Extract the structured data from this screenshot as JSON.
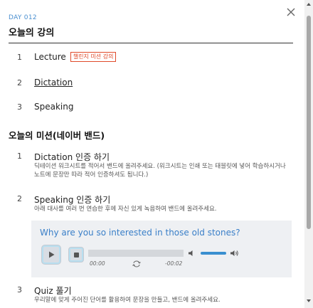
{
  "header": {
    "day": "DAY 012",
    "title": "오늘의 강의"
  },
  "lectures": [
    {
      "num": "1",
      "label": "Lecture",
      "badge": "챌린지 미션 강의"
    },
    {
      "num": "2",
      "label": "Dictation"
    },
    {
      "num": "3",
      "label": "Speaking"
    }
  ],
  "mission": {
    "title": "오늘의 미션(네이버 밴드)",
    "items": [
      {
        "num": "1",
        "title": "Dictation 인증 하기",
        "desc": "딕테이션 워크시트를 적어서 밴드에 올려주세요. (워크시트는 인쇄 또는 태블릿에 넣어 학습하시거나 노트에 문장만 따라 적어 인증하셔도 됩니다.)"
      },
      {
        "num": "2",
        "title": "Speaking 인증 하기",
        "desc": "아래 대사를 여러 번 연습한 후에 자신 있게 녹음하여 밴드에 올려주세요."
      },
      {
        "num": "3",
        "title": "Quiz 풀기",
        "desc": "우리말에 맞게 주어진 단어를 활용하여 문장을 만들고, 밴드에 올려주세요."
      }
    ]
  },
  "player": {
    "sentence": "Why are you so interested in those old stones?",
    "current_time": "00:00",
    "remaining_time": "-00:02",
    "progress": 0,
    "volume": 1.0
  },
  "colors": {
    "accent": "#3a7fc8",
    "badge": "#e04a2a",
    "player_bg": "#eef0f3"
  }
}
